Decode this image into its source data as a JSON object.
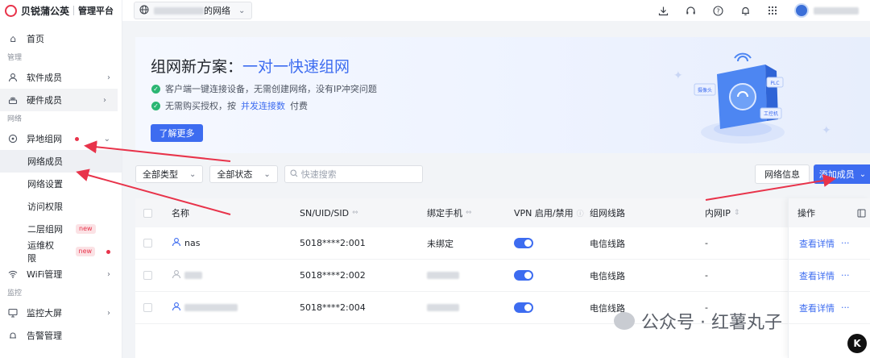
{
  "brand": {
    "name": "贝锐蒲公英",
    "sub": "管理平台"
  },
  "topbar": {
    "network_suffix": "的网络"
  },
  "sidebar": {
    "home": "首页",
    "group_manage": "管理",
    "software_members": "软件成员",
    "hardware_members": "硬件成员",
    "group_network": "网络",
    "remote_network": "异地组网",
    "network_members": "网络成员",
    "network_settings": "网络设置",
    "access_rights": "访问权限",
    "layer2_network": "二层组网",
    "ops_rights": "运维权限",
    "new_badge": "new",
    "wifi_manage": "WiFi管理",
    "group_monitor": "监控",
    "monitor_screen": "监控大屏",
    "alarm_manage": "告警管理"
  },
  "banner": {
    "title_prefix": "组网新方案：",
    "title_highlight": "一对一快速组网",
    "line1": "客户端一键连接设备，无需创建网络，没有IP冲突问题",
    "line2_prefix": "无需购买授权，按",
    "line2_link": "并发连接数",
    "line2_suffix": "付费",
    "learn_more": "了解更多",
    "tag_camera": "摄像头",
    "tag_plc": "PLC",
    "tag_ipc": "工控机"
  },
  "toolbar": {
    "type_select": "全部类型",
    "status_select": "全部状态",
    "search_placeholder": "快速搜索",
    "network_info": "网络信息",
    "add_member": "添加成员"
  },
  "table": {
    "headers": {
      "name": "名称",
      "sn": "SN/UID/SID",
      "phone": "绑定手机",
      "vpn": "VPN 启用/禁用",
      "line": "组网线路",
      "ip": "内网IP",
      "ops": "操作"
    },
    "rows": [
      {
        "name": "nas",
        "sn": "5018****2:001",
        "phone": "未绑定",
        "line": "电信线路",
        "ip": "-",
        "action": "查看详情"
      },
      {
        "name": "",
        "sn": "5018****2:002",
        "phone": "",
        "line": "电信线路",
        "ip": "-",
        "action": "查看详情"
      },
      {
        "name": "",
        "sn": "5018****2:004",
        "phone": "",
        "line": "电信线路",
        "ip": "-",
        "action": "查看详情"
      }
    ],
    "more": "···"
  },
  "watermark": {
    "text": "公众号 · 红薯丸子"
  },
  "colors": {
    "accent": "#3d6cf0",
    "brand_red": "#e8334a",
    "success": "#2bb673"
  },
  "icons": [
    "home-icon",
    "user-icon",
    "hardware-icon",
    "remote-network-icon",
    "wifi-icon",
    "monitor-icon",
    "globe-icon",
    "download-icon",
    "headset-icon",
    "help-icon",
    "bell-icon",
    "apps-icon",
    "search-icon",
    "sort-icon",
    "column-settings-icon"
  ]
}
